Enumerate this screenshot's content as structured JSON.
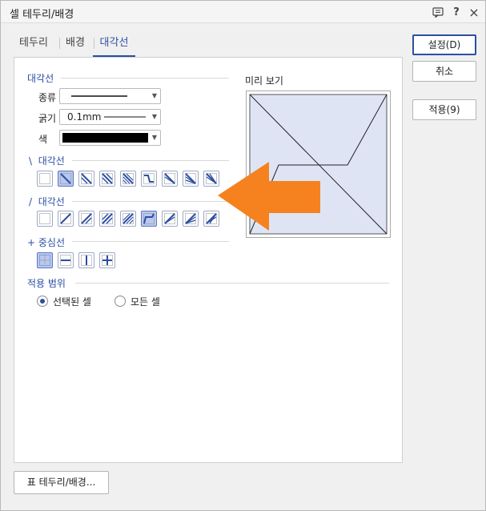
{
  "window": {
    "title": "셀 테두리/배경",
    "icons": [
      "comment-icon",
      "help-icon",
      "close-icon"
    ],
    "help_glyph": "?",
    "close_glyph": "×"
  },
  "tabs": [
    {
      "label": "테두리",
      "active": false
    },
    {
      "label": "배경",
      "active": false
    },
    {
      "label": "대각선",
      "active": true
    }
  ],
  "diagonal": {
    "section_title": "대각선",
    "type_label": "종류",
    "thickness_label": "굵기",
    "thickness_value": "0.1mm",
    "color_label": "색",
    "color_value": "#000000",
    "backslash_title": "대각선",
    "backslash_prefix": "\\",
    "slash_title": "대각선",
    "slash_prefix": "/",
    "center_title": "중심선",
    "center_prefix": "+"
  },
  "preview": {
    "label": "미리 보기",
    "cell_color": "#dfe4f5"
  },
  "apply_scope": {
    "title": "적용 범위",
    "options": [
      {
        "label": "선택된 셀",
        "selected": true
      },
      {
        "label": "모든 셀",
        "selected": false
      }
    ]
  },
  "buttons": {
    "ok": "설정(D)",
    "cancel": "취소",
    "apply": "적용(9)",
    "table_border": "표 테두리/배경..."
  },
  "annotation": {
    "arrow_color": "#f5821f"
  },
  "colors": {
    "accent": "#2b4fa3",
    "selected_bg": "#b9c8ee"
  }
}
